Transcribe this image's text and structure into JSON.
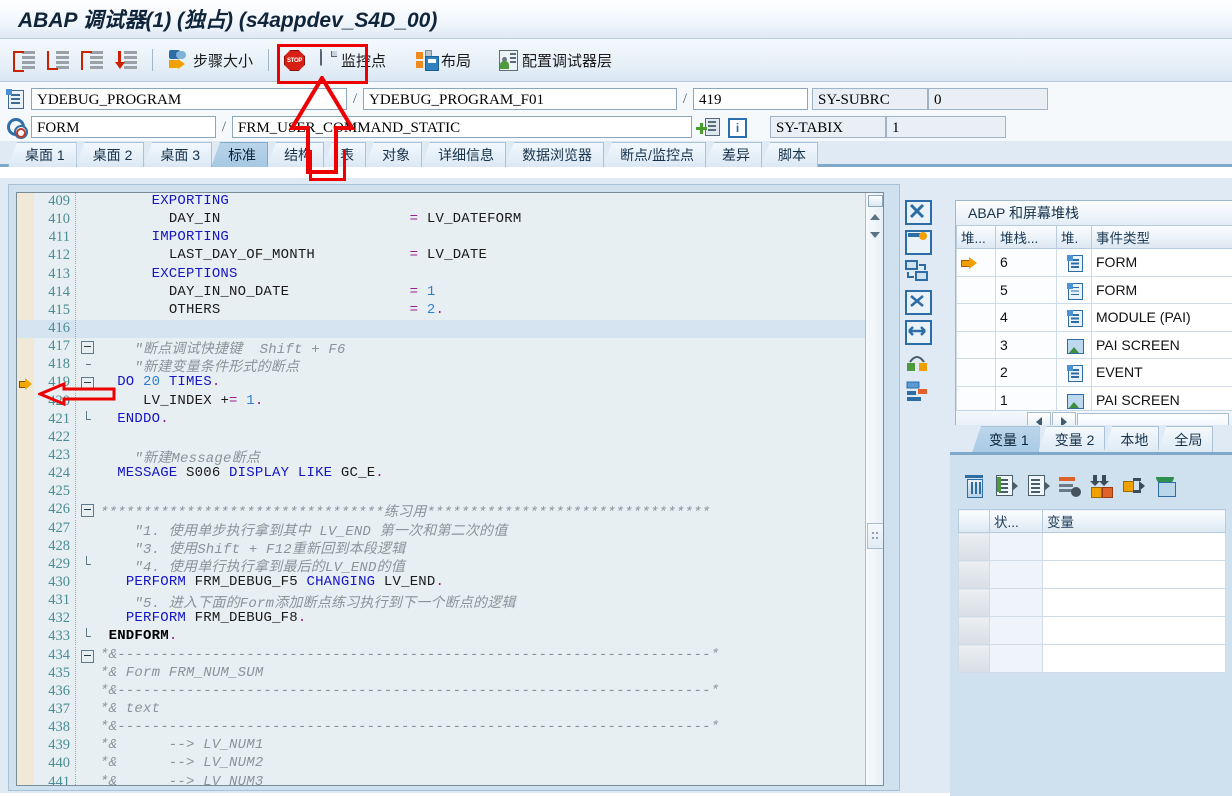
{
  "window": {
    "title": "ABAP 调试器(1) (独占) (s4appdev_S4D_00)"
  },
  "toolbar": {
    "step_into": "step-into",
    "step_over": "step-over",
    "step_return": "step-return",
    "step_continue": "step-continue",
    "step_size_label": "步骤大小",
    "stop_label": "stop",
    "watchpoint_label": "监控点",
    "layout_label": "布局",
    "configure_layer_label": "配置调试器层"
  },
  "fields": {
    "program_icon": "program-icon",
    "program": "YDEBUG_PROGRAM",
    "include": "YDEBUG_PROGRAM_F01",
    "line": "419",
    "sy_subrc_label": "SY-SUBRC",
    "sy_subrc_value": "0",
    "form_icon": "form-icon",
    "event_type": "FORM",
    "event_name": "FRM_USER_COMMAND_STATIC",
    "sy_tabix_label": "SY-TABIX",
    "sy_tabix_value": "1"
  },
  "tabs": [
    {
      "label": "桌面 1",
      "active": false
    },
    {
      "label": "桌面 2",
      "active": false
    },
    {
      "label": "桌面 3",
      "active": false
    },
    {
      "label": "标准",
      "active": true
    },
    {
      "label": "结构",
      "active": false
    },
    {
      "label": "表",
      "active": false
    },
    {
      "label": "对象",
      "active": false
    },
    {
      "label": "详细信息",
      "active": false
    },
    {
      "label": "数据浏览器",
      "active": false
    },
    {
      "label": "断点/监控点",
      "active": false
    },
    {
      "label": "差异",
      "active": false
    },
    {
      "label": "脚本",
      "active": false
    }
  ],
  "code": {
    "current_line": 419,
    "highlight_line": 416,
    "lines": [
      {
        "n": 409,
        "t": "      EXPORTING",
        "fold": ""
      },
      {
        "n": 410,
        "t": "        DAY_IN                      = LV_DATEFORM",
        "fold": ""
      },
      {
        "n": 411,
        "t": "      IMPORTING",
        "fold": ""
      },
      {
        "n": 412,
        "t": "        LAST_DAY_OF_MONTH           = LV_DATE",
        "fold": ""
      },
      {
        "n": 413,
        "t": "      EXCEPTIONS",
        "fold": ""
      },
      {
        "n": 414,
        "t": "        DAY_IN_NO_DATE              = 1",
        "fold": ""
      },
      {
        "n": 415,
        "t": "        OTHERS                      = 2.",
        "fold": ""
      },
      {
        "n": 416,
        "t": "",
        "fold": ""
      },
      {
        "n": 417,
        "t": "    \"断点调试快捷键  Shift + F6",
        "fold": "box"
      },
      {
        "n": 418,
        "t": "    \"新建变量条件形式的断点",
        "fold": "tick"
      },
      {
        "n": 419,
        "t": "  DO 20 TIMES.",
        "fold": "box-minus"
      },
      {
        "n": 420,
        "t": "     LV_INDEX += 1.",
        "fold": "bar"
      },
      {
        "n": 421,
        "t": "  ENDDO.",
        "fold": "end"
      },
      {
        "n": 422,
        "t": "",
        "fold": ""
      },
      {
        "n": 423,
        "t": "    \"新建Message断点",
        "fold": ""
      },
      {
        "n": 424,
        "t": "  MESSAGE S006 DISPLAY LIKE GC_E.",
        "fold": ""
      },
      {
        "n": 425,
        "t": "",
        "fold": ""
      },
      {
        "n": 426,
        "t": "*********************************练习用*********************************",
        "fold": "box"
      },
      {
        "n": 427,
        "t": "    \"1. 使用单步执行拿到其中 LV_END 第一次和第二次的值",
        "fold": "bar"
      },
      {
        "n": 428,
        "t": "    \"3. 使用Shift + F12重新回到本段逻辑",
        "fold": "bar"
      },
      {
        "n": 429,
        "t": "    \"4. 使用单行执行拿到最后的LV_END的值",
        "fold": "end"
      },
      {
        "n": 430,
        "t": "   PERFORM FRM_DEBUG_F5 CHANGING LV_END.",
        "fold": ""
      },
      {
        "n": 431,
        "t": "    \"5. 进入下面的Form添加断点练习执行到下一个断点的逻辑",
        "fold": ""
      },
      {
        "n": 432,
        "t": "   PERFORM FRM_DEBUG_F8.",
        "fold": ""
      },
      {
        "n": 433,
        "t": " ENDFORM.",
        "fold": "end"
      },
      {
        "n": 434,
        "t": "*&---------------------------------------------------------------------*",
        "fold": "box"
      },
      {
        "n": 435,
        "t": "*& Form FRM_NUM_SUM",
        "fold": "bar"
      },
      {
        "n": 436,
        "t": "*&---------------------------------------------------------------------*",
        "fold": "bar"
      },
      {
        "n": 437,
        "t": "*& text",
        "fold": "bar"
      },
      {
        "n": 438,
        "t": "*&---------------------------------------------------------------------*",
        "fold": "bar"
      },
      {
        "n": 439,
        "t": "*&      --> LV_NUM1",
        "fold": "bar"
      },
      {
        "n": 440,
        "t": "*&      --> LV_NUM2",
        "fold": "bar"
      },
      {
        "n": 441,
        "t": "*&      --> LV_NUM3",
        "fold": "bar"
      }
    ]
  },
  "side_tools": [
    "close-tool-icon",
    "new-window-icon",
    "swap-panel-icon",
    "maximize-icon",
    "resize-width-icon",
    "breakpoint-toggle-icon",
    "settings-icon"
  ],
  "stack": {
    "title": "ABAP 和屏幕堆栈",
    "headers": [
      "堆...",
      "堆栈...",
      "堆.",
      "事件类型"
    ],
    "rows": [
      {
        "current": true,
        "level": "6",
        "icon": "form-icon",
        "type": "FORM"
      },
      {
        "current": false,
        "level": "5",
        "icon": "form-icon",
        "type": "FORM"
      },
      {
        "current": false,
        "level": "4",
        "icon": "form-icon",
        "type": "MODULE (PAI)"
      },
      {
        "current": false,
        "level": "3",
        "icon": "screen-icon",
        "type": "PAI SCREEN"
      },
      {
        "current": false,
        "level": "2",
        "icon": "form-icon",
        "type": "EVENT"
      },
      {
        "current": false,
        "level": "1",
        "icon": "screen-icon",
        "type": "PAI SCREEN"
      },
      {
        "current": false,
        "level": "",
        "icon": "",
        "type": ""
      }
    ]
  },
  "variables": {
    "tabs": [
      {
        "label": "变量 1",
        "active": true
      },
      {
        "label": "变量 2",
        "active": false
      },
      {
        "label": "本地",
        "active": false
      },
      {
        "label": "全局",
        "active": false
      }
    ],
    "tools": [
      "delete-icon",
      "insert-row-icon",
      "copy-row-icon",
      "remove-row-icon",
      "download-icon",
      "expand-icon",
      "paste-icon"
    ],
    "headers": [
      "",
      "状...",
      "变量"
    ],
    "rows": [
      {},
      {},
      {},
      {},
      {}
    ]
  },
  "annotations": {
    "watchpoint_highlight": "red-rectangle",
    "watchpoint_pointer": "red-up-arrow",
    "tab_highlight": "red-rectangle",
    "current_line_pointer": "red-left-arrow"
  },
  "colors": {
    "accent": "#2d6ca4",
    "annotation": "#ee0000",
    "keyword": "#1414c8",
    "comment": "#8a9498",
    "linenumber": "#4a8d95",
    "gutter": "#f0e9d8"
  }
}
